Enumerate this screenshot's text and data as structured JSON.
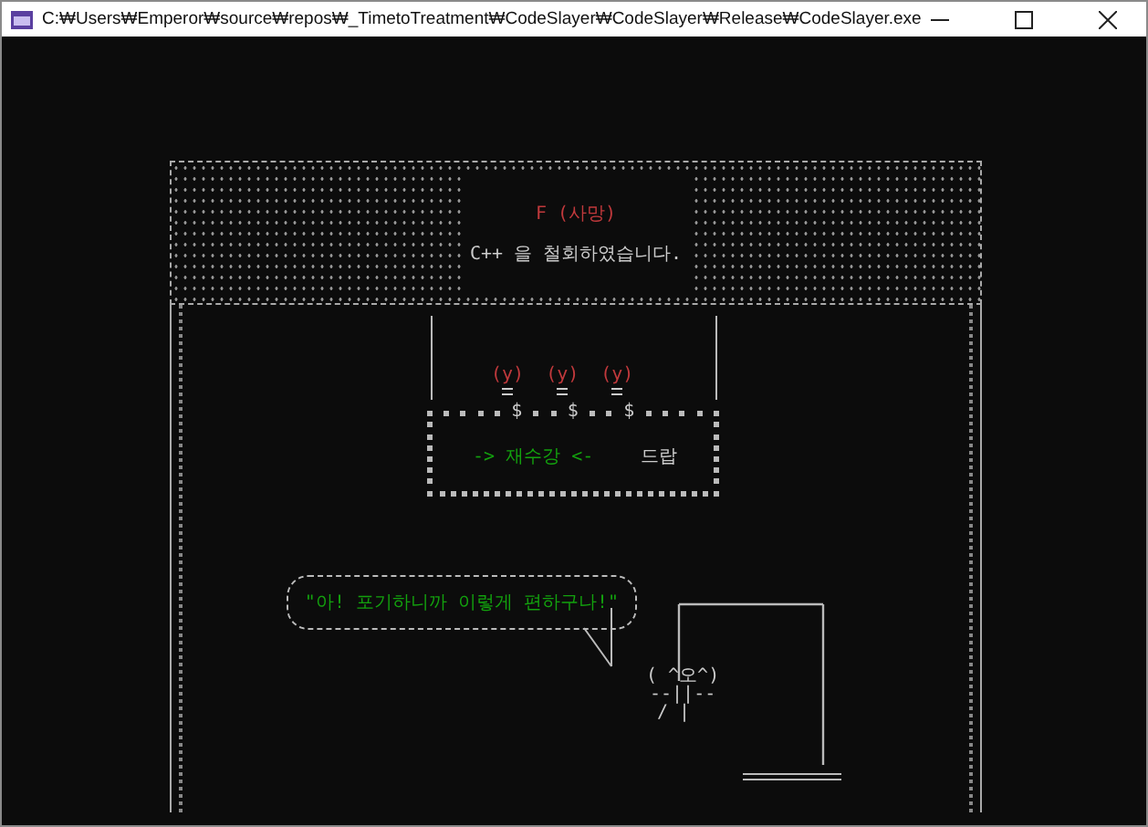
{
  "window": {
    "title": "C:₩Users₩Emperor₩source₩repos₩_TimetoTreatment₩CodeSlayer₩CodeSlayer₩Release₩CodeSlayer.exe"
  },
  "result": {
    "grade": "F (사망)",
    "message": "C++ 을 철회하였습니다."
  },
  "bulbs": [
    "(y)",
    "(y)",
    "(y)"
  ],
  "coins": [
    "$",
    "$",
    "$"
  ],
  "menu": [
    {
      "label": "-> 재수강 <-",
      "selected": true
    },
    {
      "label": "드랍",
      "selected": false
    }
  ],
  "speech": "\"아! 포기하니까 이렇게 편하구나!\"",
  "figure": {
    "face": "( ^오^)",
    "arms": "--||--",
    "legs": "/ |"
  }
}
